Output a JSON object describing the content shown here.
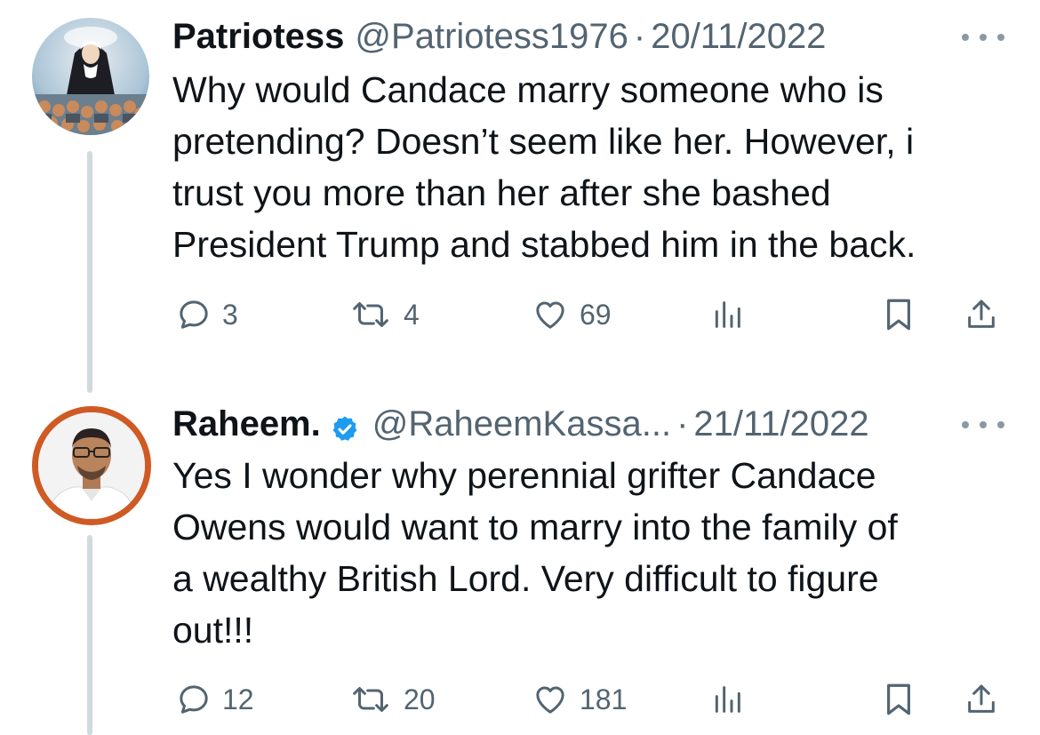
{
  "tweets": [
    {
      "display_name": "Patriotess",
      "handle": "@Patriotess1976",
      "separator": "·",
      "date": "20/11/2022",
      "verified": false,
      "text": "Why would Candace marry someone who is\npretending? Doesn’t seem like her. However, i\ntrust you more than her after she bashed\nPresident Trump and stabbed him in the back.",
      "replies": "3",
      "retweets": "4",
      "likes": "69"
    },
    {
      "display_name": "Raheem.",
      "handle": "@RaheemKassa...",
      "separator": "·",
      "date": "21/11/2022",
      "verified": true,
      "text": "Yes I wonder why perennial grifter Candace\nOwens would want to marry into the family of\na wealthy British Lord. Very difficult to figure\nout!!!",
      "replies": "12",
      "retweets": "20",
      "likes": "181"
    }
  ],
  "icons": {
    "reply": "reply-icon",
    "retweet": "retweet-icon",
    "like": "heart-icon",
    "views": "views-icon",
    "bookmark": "bookmark-icon",
    "share": "share-icon",
    "more": "more-icon",
    "verified": "verified-badge-icon"
  },
  "colors": {
    "text": "#0f1419",
    "secondary": "#536471",
    "verified": "#1d9bf0",
    "thread_line": "#cfd9de",
    "avatar_ring": "#cf5a24"
  }
}
